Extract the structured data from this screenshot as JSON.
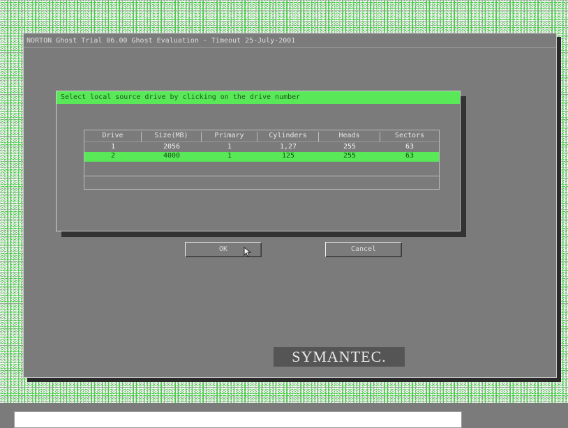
{
  "window": {
    "title": "NORTON Ghost Trial 06.00   Ghost Evaluation - Timeout 25-July-2001"
  },
  "dialog": {
    "title": "Select local source drive by clicking on the drive number",
    "columns": [
      "Drive",
      "Size(MB)",
      "Primary",
      "Cylinders",
      "Heads",
      "Sectors"
    ],
    "rows": [
      [
        "1",
        "2056",
        "1",
        "1,27",
        "255",
        "63"
      ],
      [
        "2",
        "4000",
        "1",
        "125",
        "255",
        "63"
      ]
    ],
    "selected_row": 2,
    "ok_label": "OK",
    "cancel_label": "Cancel"
  },
  "logo": {
    "text": "SYMANTEC."
  },
  "status_bar": {
    "text": ""
  },
  "colors": {
    "accent": "#58e858",
    "window": "#7b7b7b",
    "desktop": "#3fcf3f"
  }
}
